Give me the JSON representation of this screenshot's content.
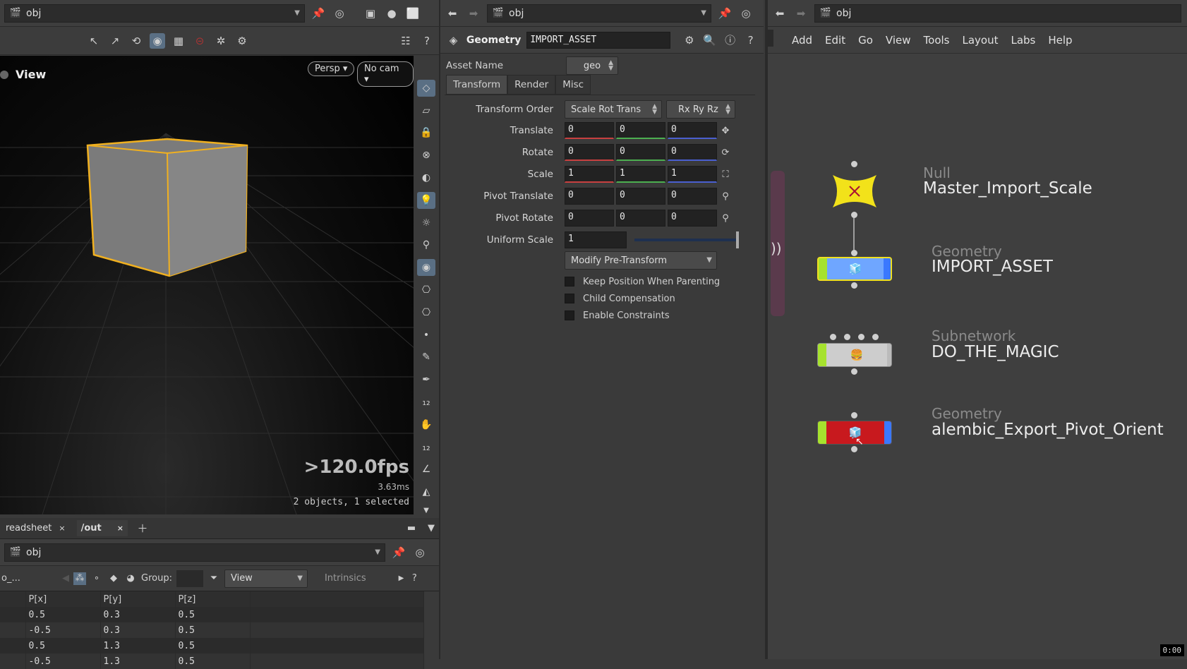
{
  "left": {
    "path": "obj",
    "viewport": {
      "title": "View",
      "persp_label": "Persp",
      "cam_label": "No cam",
      "fps": ">120.0fps",
      "ms": "3.63ms",
      "selection": "2 objects, 1 selected"
    },
    "tabs": [
      {
        "label": "readsheet"
      },
      {
        "label": "/out"
      }
    ],
    "sheet_path": "obj",
    "sheet_toolbar": {
      "node_short": "o_...",
      "group_label": "Group:",
      "view_label": "View",
      "intrinsics_label": "Intrinsics"
    },
    "sheet": {
      "columns": [
        "P[x]",
        "P[y]",
        "P[z]"
      ],
      "rows": [
        [
          "0.5",
          "0.3",
          "0.5"
        ],
        [
          "-0.5",
          "0.3",
          "0.5"
        ],
        [
          "0.5",
          "1.3",
          "0.5"
        ],
        [
          "-0.5",
          "1.3",
          "0.5"
        ]
      ]
    }
  },
  "mid": {
    "path": "obj",
    "header": {
      "type_label": "Geometry",
      "node_name": "IMPORT_ASSET"
    },
    "asset_name_label": "Asset Name",
    "asset_name_value": "geo",
    "tabs": [
      "Transform",
      "Render",
      "Misc"
    ],
    "transform_order_label": "Transform Order",
    "transform_order_value": "Scale Rot Trans",
    "rot_order_value": "Rx Ry Rz",
    "params": [
      {
        "label": "Translate",
        "x": "0",
        "y": "0",
        "z": "0"
      },
      {
        "label": "Rotate",
        "x": "0",
        "y": "0",
        "z": "0"
      },
      {
        "label": "Scale",
        "x": "1",
        "y": "1",
        "z": "1"
      },
      {
        "label": "Pivot Translate",
        "x": "0",
        "y": "0",
        "z": "0"
      },
      {
        "label": "Pivot Rotate",
        "x": "0",
        "y": "0",
        "z": "0"
      }
    ],
    "uniform_scale_label": "Uniform Scale",
    "uniform_scale_value": "1",
    "modify_pretransform_label": "Modify Pre-Transform",
    "checkboxes": [
      {
        "label": "Keep Position When Parenting"
      },
      {
        "label": "Child Compensation"
      },
      {
        "label": "Enable Constraints"
      }
    ]
  },
  "right": {
    "path": "obj",
    "menu": [
      "Add",
      "Edit",
      "Go",
      "View",
      "Tools",
      "Layout",
      "Labs",
      "Help"
    ],
    "nodes": [
      {
        "type": "Null",
        "name": "Master_Import_Scale"
      },
      {
        "type": "Geometry",
        "name": "IMPORT_ASSET"
      },
      {
        "type": "Subnetwork",
        "name": "DO_THE_MAGIC"
      },
      {
        "type": "Geometry",
        "name": "alembic_Export_Pivot_Orient"
      }
    ],
    "clock": "0:00"
  },
  "colors": {
    "selection_outline": "#f0b020",
    "null_node": "#f2e21a",
    "geo_node_blue": "#6fa6ff",
    "geo_node_red": "#c8191e",
    "display_flag": "#a6e22e",
    "render_flag": "#3aa0ff"
  }
}
